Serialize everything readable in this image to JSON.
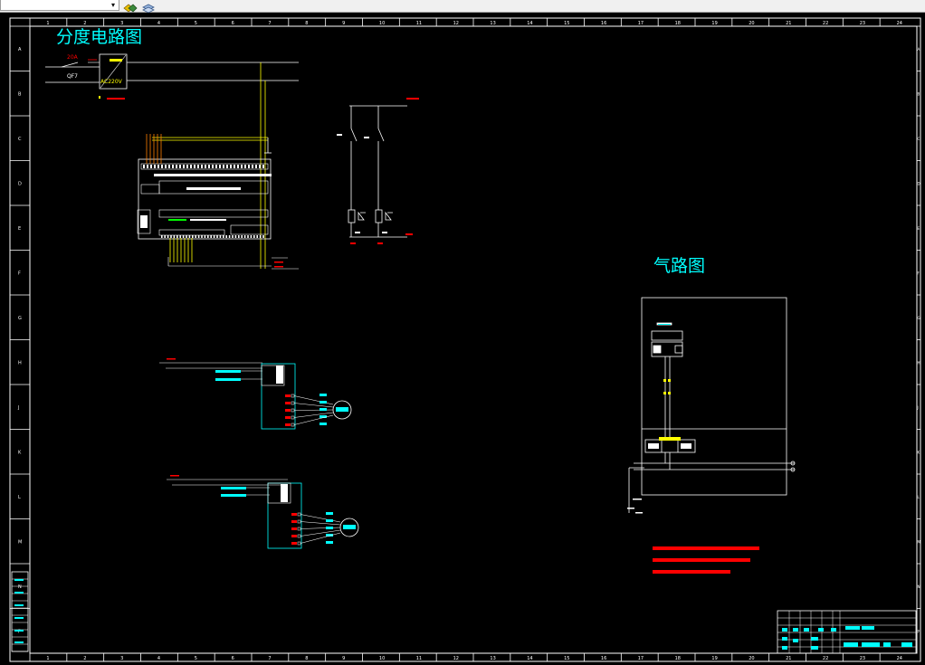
{
  "toolbar": {
    "layer_dropdown_value": "",
    "icons": [
      "layer-state-icon",
      "layer-properties-icon"
    ]
  },
  "drawing": {
    "title_distribution": "分度电路图",
    "title_pneumatic": "气路图",
    "label_fuse_current": "20A",
    "label_qf": "QF7",
    "label_ac_voltage": "AC220V",
    "frame_rows": [
      "A",
      "B",
      "C",
      "D",
      "E",
      "F",
      "G",
      "H",
      "J",
      "K",
      "L",
      "M",
      "N",
      "P"
    ],
    "frame_cols": [
      "1",
      "2",
      "3",
      "4",
      "5",
      "6",
      "7",
      "8",
      "9",
      "10",
      "11",
      "12",
      "13",
      "14",
      "15",
      "16",
      "17",
      "18",
      "19",
      "20",
      "21",
      "22",
      "23",
      "24"
    ]
  },
  "colors": {
    "background": "#000000",
    "frame": "#ffffff",
    "wire_yellow": "#ffff00",
    "component_cyan": "#00ffff",
    "annotation_red": "#ff0000",
    "wire_white": "#ffffff",
    "wire_green": "#00ff00",
    "wire_orange": "#ff8000"
  }
}
